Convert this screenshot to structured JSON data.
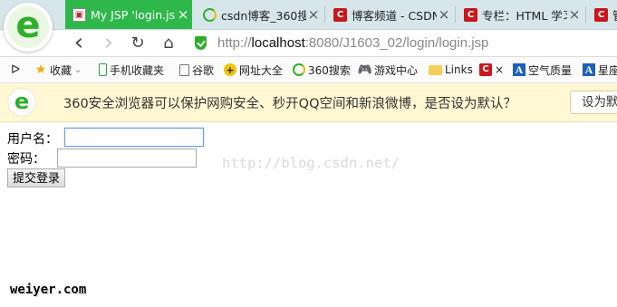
{
  "tabs": [
    {
      "title": "My JSP 'login.js",
      "icon": "jsp-page-icon",
      "active": true
    },
    {
      "title": "csdn博客_360搜",
      "icon": "360-search-icon",
      "active": false
    },
    {
      "title": "博客频道 - CSDN",
      "icon": "csdn-icon",
      "active": false
    },
    {
      "title": "专栏：HTML 学习",
      "icon": "csdn-icon",
      "active": false
    },
    {
      "title": "管",
      "icon": "csdn-icon",
      "active": false
    }
  ],
  "icons": {
    "close": "×",
    "back": "‹",
    "forward": "›",
    "reload": "↻",
    "home": "⌂"
  },
  "address": {
    "scheme": "http://",
    "host": "localhost",
    "path": ":8080/J1603_02/login/login.jsp"
  },
  "bookmarks": [
    {
      "label": "",
      "icon": "sidebar-toggle-icon"
    },
    {
      "label": "收藏",
      "icon": "star-icon",
      "dropdown": "⌄"
    },
    {
      "label": "手机收藏夹",
      "icon": "phone-icon"
    },
    {
      "label": "谷歌",
      "icon": "document-icon"
    },
    {
      "label": "网址大全",
      "icon": "plus-circle-icon"
    },
    {
      "label": "360搜索",
      "icon": "360-search-icon"
    },
    {
      "label": "游戏中心",
      "icon": "gamepad-icon"
    },
    {
      "label": "Links",
      "icon": "folder-icon"
    },
    {
      "label": "×",
      "icon": "csdn-icon"
    },
    {
      "label": "空气质量",
      "icon": "a-icon"
    },
    {
      "label": "星座",
      "icon": "a-icon"
    }
  ],
  "notification": {
    "message": "360安全浏览器可以保护网购安全、秒开QQ空间和新浪微博，是否设为默认？",
    "button": "设为默认"
  },
  "form": {
    "username_label": "用户名：",
    "username_value": "",
    "password_label": "密码：",
    "password_value": "",
    "submit_label": "提交登录"
  },
  "watermark": "http://blog.csdn.net/",
  "site_mark": "weiyer.com",
  "colors": {
    "active_tab": "#2fb84a",
    "brand_green": "#2fae2d",
    "csdn_red": "#c9171b",
    "notification_bg": "#fff8d3"
  }
}
